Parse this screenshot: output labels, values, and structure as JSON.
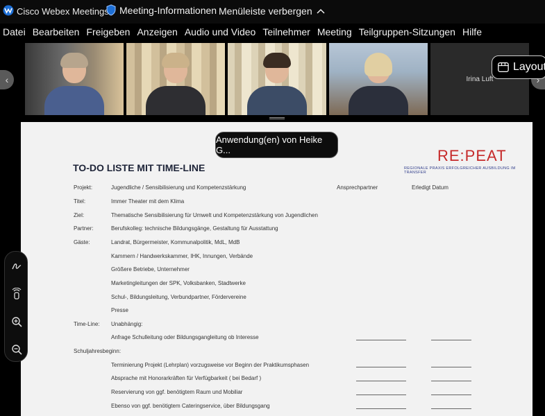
{
  "titlebar": {
    "app_name": "Cisco Webex Meetings",
    "meeting_info": "Meeting-Informationen",
    "hide_menu": "Menüleiste verbergen"
  },
  "menu": [
    {
      "label": "Datei"
    },
    {
      "label": "Bearbeiten"
    },
    {
      "label": "Freigeben"
    },
    {
      "label": "Anzeigen"
    },
    {
      "label": "Audio und Video"
    },
    {
      "label": "Teilnehmer"
    },
    {
      "label": "Meeting"
    },
    {
      "label": "Teilgruppen-Sitzungen"
    },
    {
      "label": "Hilfe"
    }
  ],
  "participants": {
    "named_tile": "Irina Luft"
  },
  "layout_button": "Layout",
  "share_banner": "Anwendung(en) von Heike G...",
  "document": {
    "title": "TO-DO LISTE MIT TIME-LINE",
    "logo": "RE:PEAT",
    "logo_sub": "REGIONALE PRAXIS ERFOLGREICHER AUSBILDUNG IM TRANSFER",
    "col_contact": "Ansprechpartner",
    "col_done": "Erledigt Datum",
    "rows": [
      {
        "label": "Projekt:",
        "text": "Jugendliche / Sensibilisierung und Kompetenzstärkung"
      },
      {
        "label": "Titel:",
        "text": "Immer Theater mit dem Klima"
      },
      {
        "label": "Ziel:",
        "text": "Thematische Sensibilisierung für Umwelt und Kompetenzstärkung von Jugendlichen"
      },
      {
        "label": "Partner:",
        "text": "Berufskolleg: technische Bildungsgänge, Gestaltung für Ausstattung"
      },
      {
        "label": "Gäste:",
        "text": "Landrat, Bürgermeister, Kommunalpolitik, MdL, MdB"
      },
      {
        "label": "",
        "text": "Kammern / Handwerkskammer, IHK, Innungen, Verbände"
      },
      {
        "label": "",
        "text": "Größere Betriebe, Unternehmer"
      },
      {
        "label": "",
        "text": "Marketingleitungen der SPK, Volksbanken, Stadtwerke"
      },
      {
        "label": "",
        "text": "Schul-, Bildungsleitung, Verbundpartner, Fördervereine"
      },
      {
        "label": "",
        "text": "Presse"
      },
      {
        "label": "Time-Line:",
        "text": "Unabhängig:"
      },
      {
        "label": "",
        "text": "Anfrage Schulleitung oder Bildungsgangleitung ob Interesse"
      },
      {
        "label": "Schuljahresbeginn:",
        "text": ""
      },
      {
        "label": "",
        "text": "Terminierung Projekt (Lehrplan) vorzugsweise vor Beginn der Praktikumsphasen"
      },
      {
        "label": "",
        "text": "Absprache mit Honorarkräften für Verfügbarkeit ( bei Bedarf )"
      },
      {
        "label": "",
        "text": "Reservierung von ggf. benötigtem Raum und Mobiliar"
      },
      {
        "label": "",
        "text": "Ebenso von ggf. benötigtem Cateringservice, über Bildungsgang"
      }
    ]
  },
  "colors": {
    "background": "#000000",
    "document": "#f2f2f2",
    "logo": "#c62a2a",
    "logo_sub": "#2f3c8a"
  },
  "icons": [
    "webex-logo-icon",
    "shield-icon",
    "chevron-up-icon",
    "chevron-left-icon",
    "chevron-right-icon",
    "layout-icon",
    "annotate-icon",
    "pointer-icon",
    "zoom-in-icon",
    "zoom-out-icon"
  ]
}
